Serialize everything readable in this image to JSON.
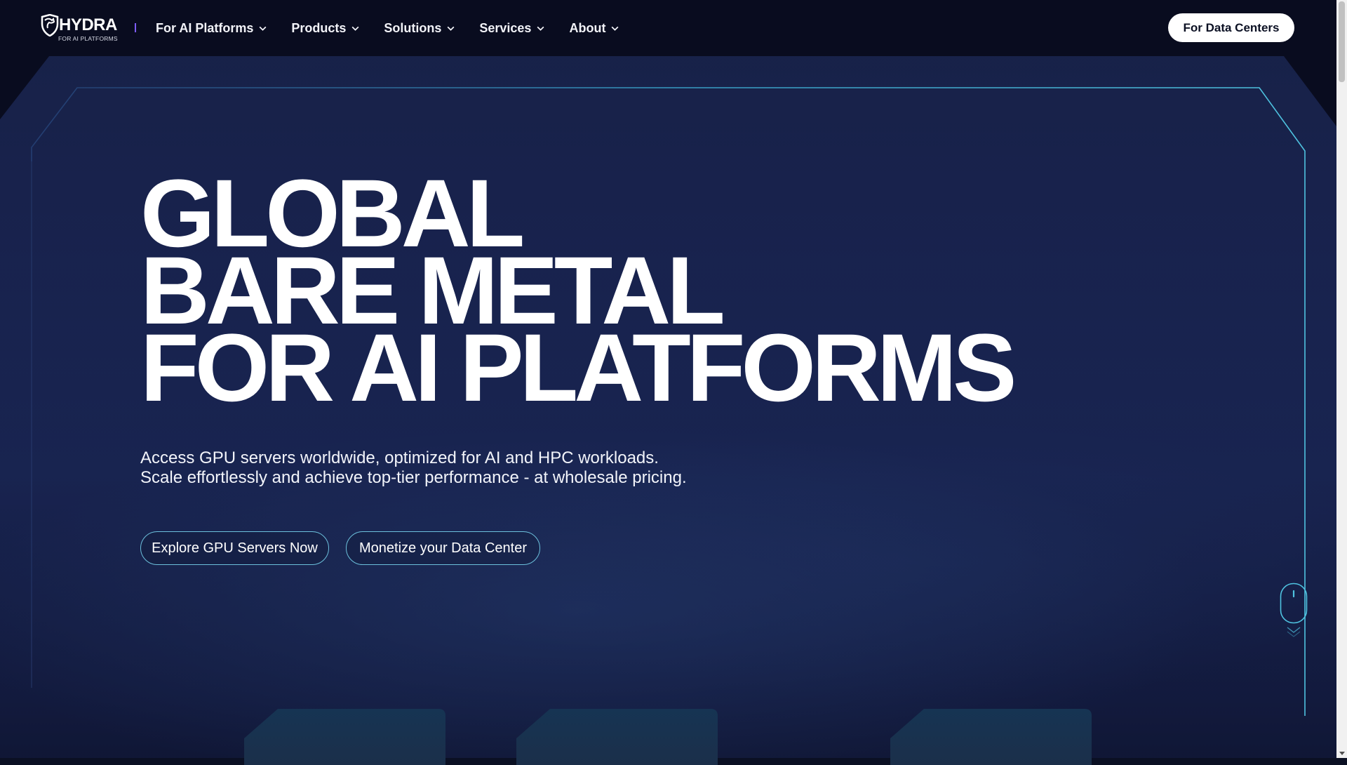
{
  "brand": {
    "name": "HYDRA",
    "tagline": "FOR AI PLATFORMS"
  },
  "nav": {
    "items": [
      {
        "label": "For AI Platforms"
      },
      {
        "label": "Products"
      },
      {
        "label": "Solutions"
      },
      {
        "label": "Services"
      },
      {
        "label": "About"
      }
    ],
    "cta_label": "For Data Centers"
  },
  "hero": {
    "headline": [
      "GLOBAL",
      "BARE METAL",
      "FOR AI PLATFORMS"
    ],
    "subtext": [
      "Access GPU servers worldwide, optimized for AI and HPC workloads.",
      "Scale effortlessly and achieve top-tier performance - at wholesale pricing."
    ],
    "primary_button": "Explore GPU Servers Now",
    "secondary_button": "Monetize your Data Center"
  },
  "icons": {
    "logo": "hydra-shield-icon",
    "nav_dropdown": "chevron-down-icon",
    "scroll": "mouse-scroll-icon"
  },
  "colors": {
    "background": "#0b1023",
    "accent_cyan": "#4fc3e0",
    "separator_purple": "#7d5cff",
    "cta_bg": "#ffffff"
  }
}
